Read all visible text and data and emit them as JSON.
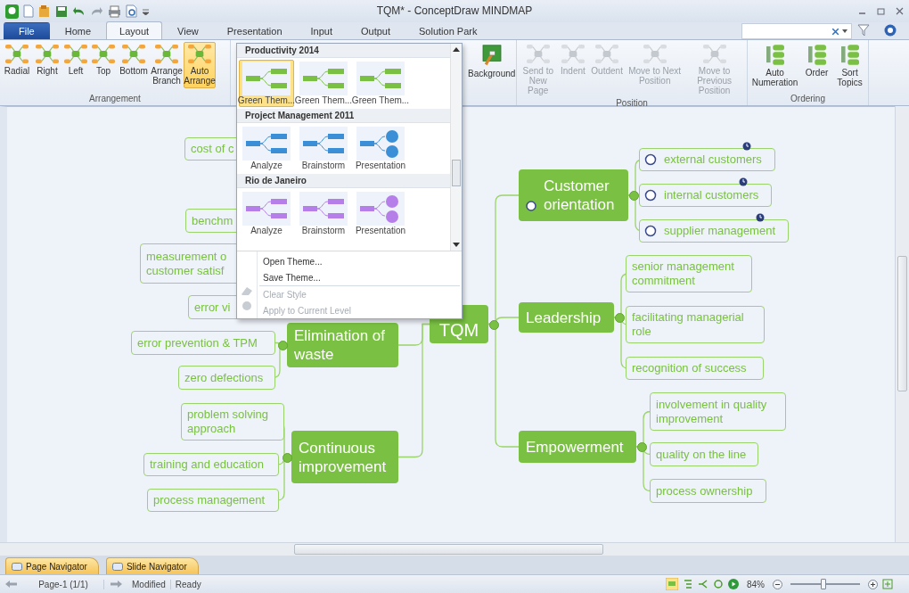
{
  "window": {
    "title": "TQM* - ConceptDraw MINDMAP"
  },
  "tabs": [
    {
      "label": "File",
      "kind": "file",
      "selected": false
    },
    {
      "label": "Home",
      "kind": "tab",
      "selected": false
    },
    {
      "label": "Layout",
      "kind": "tab",
      "selected": true
    },
    {
      "label": "View",
      "kind": "tab",
      "selected": false
    },
    {
      "label": "Presentation",
      "kind": "tab",
      "selected": false
    },
    {
      "label": "Input",
      "kind": "tab",
      "selected": false
    },
    {
      "label": "Output",
      "kind": "tab",
      "selected": false
    },
    {
      "label": "Solution Park",
      "kind": "tab",
      "selected": false
    }
  ],
  "ribbon": [
    {
      "label": "Arrangement",
      "buttons": [
        {
          "label": "Radial",
          "disabled": false,
          "selected": false
        },
        {
          "label": "Right",
          "disabled": false,
          "selected": false
        },
        {
          "label": "Left",
          "disabled": false,
          "selected": false
        },
        {
          "label": "Top",
          "disabled": false,
          "selected": false
        },
        {
          "label": "Bottom",
          "disabled": false,
          "selected": false
        },
        {
          "label": "Arrange Branch",
          "disabled": false,
          "selected": false
        },
        {
          "label": "Auto Arrange",
          "disabled": false,
          "selected": true
        }
      ]
    },
    {
      "buttons": [
        {
          "label": "Background",
          "disabled": false,
          "selected": false
        }
      ]
    },
    {
      "label": "Position",
      "buttons": [
        {
          "label": "Send to New Page",
          "disabled": true,
          "selected": false
        },
        {
          "label": "Indent",
          "disabled": true,
          "selected": false
        },
        {
          "label": "Outdent",
          "disabled": true,
          "selected": false
        },
        {
          "label": "Move to Next Position",
          "disabled": true,
          "selected": false
        },
        {
          "label": "Move to Previous Position",
          "disabled": true,
          "selected": false
        }
      ]
    },
    {
      "label": "Ordering",
      "buttons": [
        {
          "label": "Auto Numeration",
          "disabled": false,
          "selected": false
        },
        {
          "label": "Order",
          "disabled": false,
          "selected": false
        },
        {
          "label": "Sort Topics",
          "disabled": false,
          "selected": false
        }
      ]
    }
  ],
  "theme_menu": {
    "sections": [
      {
        "title": "Productivity 2014",
        "color": "#7ac143",
        "items": [
          {
            "label": "Green Them...",
            "selected": true
          },
          {
            "label": "Green Them...",
            "selected": false
          },
          {
            "label": "Green Them...",
            "selected": false
          }
        ]
      },
      {
        "title": "Project Management 2011",
        "color": "#3a8fd6",
        "items": [
          {
            "label": "Analyze",
            "selected": false
          },
          {
            "label": "Brainstorm",
            "selected": false
          },
          {
            "label": "Presentation",
            "selected": false
          }
        ]
      },
      {
        "title": "Rio de Janeiro",
        "color": "#b57ee8",
        "items": [
          {
            "label": "Analyze",
            "selected": false
          },
          {
            "label": "Brainstorm",
            "selected": false
          },
          {
            "label": "Presentation",
            "selected": false
          }
        ]
      }
    ],
    "commands": [
      {
        "label": "Open Theme...",
        "disabled": false
      },
      {
        "label": "Save Theme...",
        "disabled": false
      },
      {
        "label": "Clear Style",
        "disabled": true
      },
      {
        "label": "Apply to Current Level",
        "disabled": true
      }
    ]
  },
  "map": {
    "center": "TQM",
    "branches": [
      {
        "text": "Customer orientation",
        "task": true,
        "children": [
          {
            "text": "external customers",
            "task": true
          },
          {
            "text": "internal customers",
            "task": true
          },
          {
            "text": "supplier management",
            "task": true
          }
        ]
      },
      {
        "text": "Leadership",
        "task": false,
        "children": [
          {
            "text": "senior management commitment",
            "task": false
          },
          {
            "text": "facilitating managerial role",
            "task": false
          },
          {
            "text": "recognition of success",
            "task": false
          }
        ]
      },
      {
        "text": "Empowerment",
        "task": false,
        "children": [
          {
            "text": "involvement in quality improvement",
            "task": false
          },
          {
            "text": "quality on the line",
            "task": false
          },
          {
            "text": "process ownership",
            "task": false
          }
        ]
      },
      {
        "text": "Elimination of waste",
        "task": false,
        "children": [
          {
            "text": "error prevention & TPM",
            "task": false
          },
          {
            "text": "zero defections",
            "task": false
          }
        ]
      },
      {
        "text": "Continuous improvement",
        "task": false,
        "children": [
          {
            "text": "problem solving approach",
            "task": false
          },
          {
            "text": "training and education",
            "task": false
          },
          {
            "text": "process management",
            "task": false
          }
        ]
      }
    ],
    "partly_hidden_topics": [
      "cost of c",
      "benchm",
      "measurement o customer satisf",
      "error vi"
    ]
  },
  "navigator_tabs": [
    "Page Navigator",
    "Slide Navigator"
  ],
  "status_bar": {
    "page": "Page-1 (1/1)",
    "modified": "Modified",
    "state": "Ready",
    "zoom": "84%",
    "zoom_slider": {
      "level": 0.48
    }
  }
}
